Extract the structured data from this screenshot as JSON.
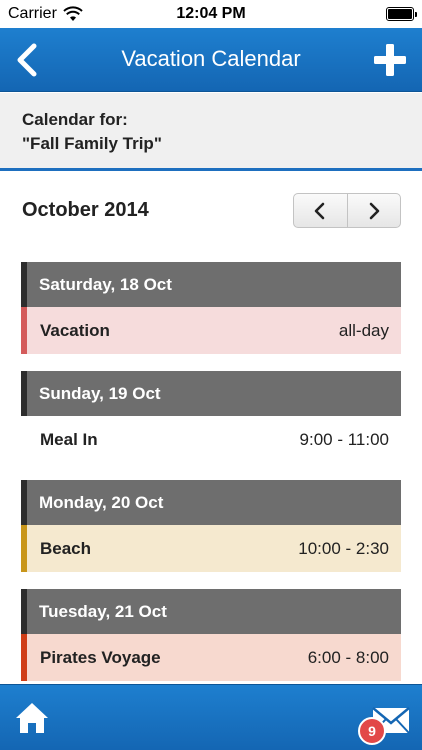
{
  "status_bar": {
    "carrier": "Carrier",
    "time": "12:04 PM",
    "battery_level": 1.0
  },
  "nav": {
    "title": "Vacation Calendar",
    "back_icon": "chevron-left-icon",
    "add_icon": "plus-icon"
  },
  "calendar_for": {
    "label": "Calendar for:",
    "name": "\"Fall Family Trip\""
  },
  "month": {
    "title": "October 2014",
    "prev_icon": "chevron-left-icon",
    "next_icon": "chevron-right-icon"
  },
  "days": [
    {
      "label": "Saturday, 18 Oct",
      "event": {
        "title": "Vacation",
        "time": "all-day",
        "bg": "#f6dcdc",
        "accent": "#d45b5b"
      }
    },
    {
      "label": "Sunday, 19 Oct",
      "event": {
        "title": "Meal In",
        "time": "9:00 - 11:00",
        "bg": "#ffffff",
        "accent": "#ffffff"
      }
    },
    {
      "label": "Monday, 20 Oct",
      "event": {
        "title": "Beach",
        "time": "10:00 - 2:30",
        "bg": "#f5e9cf",
        "accent": "#c8961b"
      }
    },
    {
      "label": "Tuesday, 21 Oct",
      "event": {
        "title": "Pirates Voyage",
        "time": "6:00 - 8:00",
        "bg": "#f7d9cf",
        "accent": "#cf3e18"
      }
    }
  ],
  "tab_bar": {
    "home_icon": "home-icon",
    "mail_icon": "envelope-icon",
    "badge": "9"
  },
  "colors": {
    "brand_blue": "#1a74c4",
    "day_header": "#6e6e6e",
    "badge_red": "#e24848"
  }
}
